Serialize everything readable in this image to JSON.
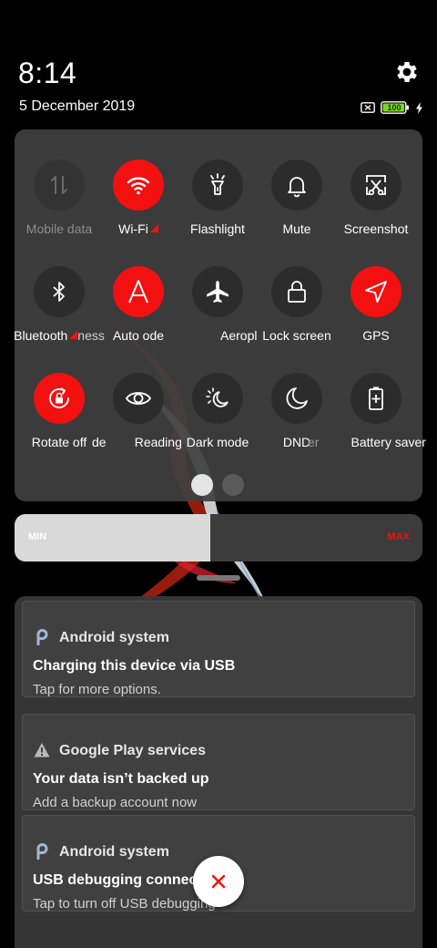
{
  "status": {
    "time": "8:14",
    "date": "5 December 2019",
    "battery_level": "100",
    "charging": true,
    "icons": [
      "settings-gear-icon",
      "no-sim-icon",
      "battery-icon",
      "charging-bolt-icon"
    ]
  },
  "quick_settings": {
    "page_count": 2,
    "active_page": 0,
    "tiles": [
      {
        "label": "Mobile data",
        "icon": "mobile-data-icon",
        "state": "off",
        "label_muted": true
      },
      {
        "label": "Wi-Fi",
        "icon": "wifi-icon",
        "state": "on",
        "marker": true
      },
      {
        "label": "Flashlight",
        "icon": "flashlight-icon",
        "state": "off"
      },
      {
        "label": "Mute",
        "icon": "bell-icon",
        "state": "off"
      },
      {
        "label": "Screenshot",
        "icon": "screenshot-icon",
        "state": "off"
      },
      {
        "label": "Bluetooth",
        "icon": "bluetooth-icon",
        "state": "off",
        "marker": true
      },
      {
        "label": "Auto",
        "icon": "auto-brightness-icon",
        "state": "on"
      },
      {
        "label": "Aeroplane mode",
        "icon": "airplane-icon",
        "state": "off"
      },
      {
        "label": "Lock screen",
        "icon": "lock-icon",
        "state": "off"
      },
      {
        "label": "GPS",
        "icon": "location-arrow-icon",
        "state": "on"
      },
      {
        "label": "Rotate off",
        "icon": "rotation-lock-icon",
        "state": "on"
      },
      {
        "label": "Reading mode",
        "icon": "eye-icon",
        "state": "off"
      },
      {
        "label": "Dark mode",
        "icon": "dark-mode-icon",
        "state": "off"
      },
      {
        "label": "DND",
        "icon": "moon-icon",
        "state": "off"
      },
      {
        "label": "Battery saver",
        "icon": "battery-saver-icon",
        "state": "off"
      }
    ],
    "behind_text": [
      "ness",
      "ode",
      "de",
      "er"
    ]
  },
  "brightness": {
    "min_label": "MIN",
    "max_label": "MAX",
    "level": 0.48
  },
  "notifications": [
    {
      "app": "Android system",
      "icon": "android-system-icon",
      "title": "Charging this device via USB",
      "text": "Tap for more options."
    },
    {
      "app": "Google Play services",
      "icon": "warning-icon",
      "title": "Your data isn’t backed up",
      "text": "Add a backup account now"
    },
    {
      "app": "Android system",
      "icon": "android-system-icon",
      "title": "USB debugging connected",
      "text": "Tap to turn off USB debugging"
    }
  ],
  "colors": {
    "accent": "#f31010",
    "panel": "#404040",
    "battery_green": "#7ed321"
  }
}
